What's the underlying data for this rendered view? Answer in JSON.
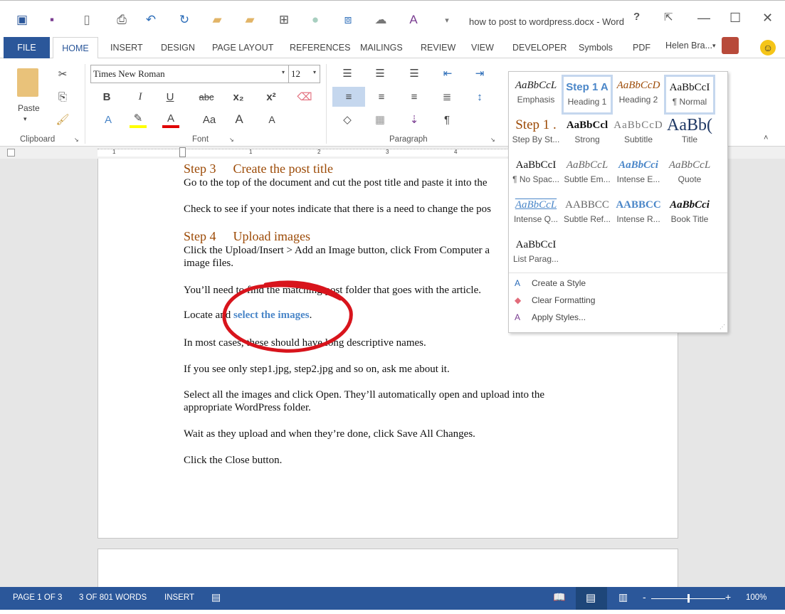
{
  "window": {
    "title": "how to post to wordpress.docx - Word",
    "help": "?",
    "restore_ribbon": "⇱",
    "minimize": "—",
    "maximize": "☐",
    "close": "✕"
  },
  "qat": [
    "word-icon",
    "save-icon",
    "new-icon",
    "print-preview-icon",
    "undo-icon",
    "redo-icon",
    "open-icon",
    "open-recent-icon",
    "layout-icon",
    "circle-icon",
    "picture-icon",
    "shape-icon",
    "spelling-icon",
    "customize-icon"
  ],
  "tabs": {
    "file": "FILE",
    "home": "HOME",
    "items": [
      "INSERT",
      "DESIGN",
      "PAGE LAYOUT",
      "REFERENCES",
      "MAILINGS",
      "REVIEW",
      "VIEW",
      "DEVELOPER",
      "Symbols",
      "PDF"
    ],
    "user": "Helen Bra...",
    "accent": "#2b579a"
  },
  "ribbon": {
    "clipboard": {
      "label": "Clipboard",
      "paste": "Paste"
    },
    "font": {
      "label": "Font",
      "name": "Times New Roman",
      "size": "12",
      "bold": "B",
      "italic": "I",
      "underline": "U",
      "strike": "abc",
      "subscript": "x₂",
      "superscript": "x²",
      "change_case": "Aa",
      "grow": "A",
      "shrink": "A"
    },
    "paragraph": {
      "label": "Paragraph",
      "pilcrow": "¶"
    }
  },
  "styles_gallery": {
    "items": [
      {
        "preview": "AaBbCcL",
        "name": "Emphasis"
      },
      {
        "preview": "Step 1  A",
        "name": "Heading 1"
      },
      {
        "preview": "AaBbCcD",
        "name": "Heading 2"
      },
      {
        "preview": "AaBbCcI",
        "name": "¶ Normal"
      },
      {
        "preview": "Step 1  .",
        "name": "Step By St..."
      },
      {
        "preview": "AaBbCcl",
        "name": "Strong"
      },
      {
        "preview": "AaBbCcD",
        "name": "Subtitle"
      },
      {
        "preview": "AaBb(",
        "name": "Title"
      },
      {
        "preview": "AaBbCcI",
        "name": "¶ No Spac..."
      },
      {
        "preview": "AaBbCcL",
        "name": "Subtle Em..."
      },
      {
        "preview": "AaBbCci",
        "name": "Intense E..."
      },
      {
        "preview": "AaBbCcL",
        "name": "Quote"
      },
      {
        "preview": "AaBbCcL",
        "name": "Intense Q..."
      },
      {
        "preview": "AABBCC",
        "name": "Subtle Ref..."
      },
      {
        "preview": "AABBCC",
        "name": "Intense R..."
      },
      {
        "preview": "AaBbCci",
        "name": "Book Title"
      },
      {
        "preview": "AaBbCcI",
        "name": "List Parag..."
      }
    ],
    "selected": [
      "Heading 1",
      "¶ Normal"
    ],
    "menu": [
      "Create a Style",
      "Clear Formatting",
      "Apply Styles..."
    ]
  },
  "ruler": {
    "marks": [
      "1",
      "1",
      "2",
      "3",
      "4"
    ]
  },
  "document": {
    "step3_num": "Step 3",
    "step3_title": "Create the post title",
    "p1": "Go to the top of the document and cut the post title and paste it into the",
    "p2": "Check to see if your notes indicate that there is a need to change the pos",
    "step4_num": "Step 4",
    "step4_title": "Upload images",
    "p3a": "Click the Upload/Insert > Add an Image button, click From Computer a",
    "p3b": "image files.",
    "p4": "You’ll need to find the matching post folder that goes with the article.",
    "p5_pre": "Locate and ",
    "p5_link": "select the images",
    "p5_post": ".",
    "p6": "In most cases, these should have long descriptive names.",
    "p7": "If you see only step1.jpg, step2.jpg and so on, ask me about it.",
    "p8a": "Select all the images and click Open. They’ll automatically open and upload into the",
    "p8b": "appropriate WordPress folder.",
    "p9": "Wait as they upload and when they’re done, click Save All Changes.",
    "p10": "Click the Close button.",
    "heading_color": "#9c4a06",
    "link_color": "#4a86c8",
    "annotation_color": "#d8141c"
  },
  "status": {
    "page": "PAGE 1 OF 3",
    "words": "3 OF 801 WORDS",
    "mode": "INSERT",
    "zoom": "100%",
    "zoom_level_percent": 100,
    "minus": "-",
    "plus": "+"
  }
}
